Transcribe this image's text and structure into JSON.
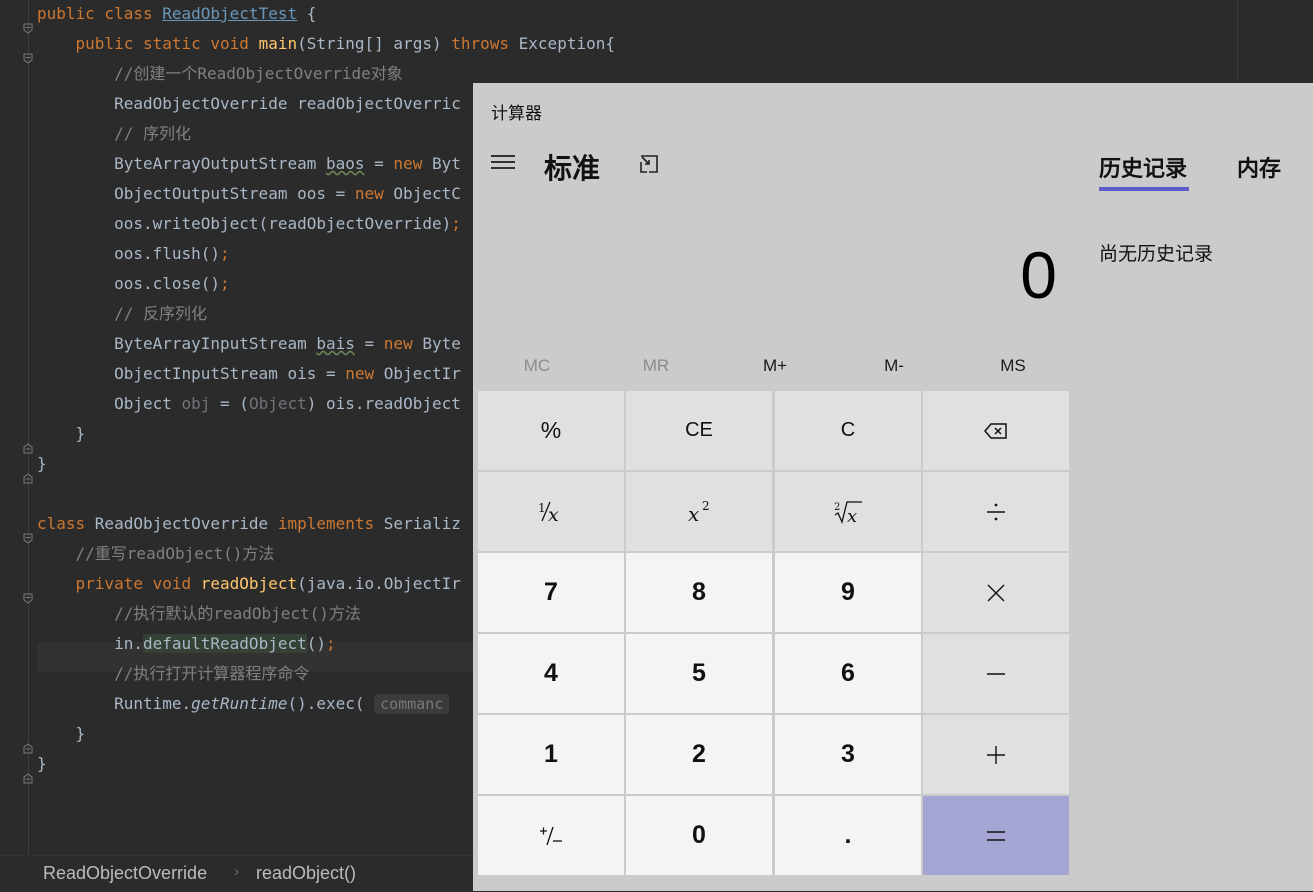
{
  "editor": {
    "lines": [
      {
        "tokens": [
          [
            "kw",
            "public class "
          ],
          [
            "cls-link",
            "ReadObjectTest"
          ],
          [
            "",
            " {"
          ]
        ]
      },
      {
        "tokens": [
          [
            "",
            "    "
          ],
          [
            "kw",
            "public static void "
          ],
          [
            "fn",
            "main"
          ],
          [
            "",
            "(String[] args) "
          ],
          [
            "kw",
            "throws "
          ],
          [
            "",
            "Exception{"
          ]
        ]
      },
      {
        "tokens": [
          [
            "",
            "        "
          ],
          [
            "cm",
            "//创建一个ReadObjectOverride对象"
          ]
        ]
      },
      {
        "tokens": [
          [
            "",
            "        ReadObjectOverride readObjectOverric"
          ]
        ]
      },
      {
        "tokens": [
          [
            "",
            "        "
          ],
          [
            "cm",
            "// 序列化"
          ]
        ]
      },
      {
        "tokens": [
          [
            "",
            "        ByteArrayOutputStream "
          ],
          [
            "wave",
            "baos"
          ],
          [
            "",
            " = "
          ],
          [
            "kw",
            "new "
          ],
          [
            "",
            "Byt"
          ]
        ]
      },
      {
        "tokens": [
          [
            "",
            "        ObjectOutputStream oos = "
          ],
          [
            "kw",
            "new "
          ],
          [
            "",
            "ObjectC"
          ]
        ]
      },
      {
        "tokens": [
          [
            "",
            "        oos.writeObject(readObjectOverride)"
          ],
          [
            "kw",
            ";"
          ]
        ]
      },
      {
        "tokens": [
          [
            "",
            "        oos.flush()"
          ],
          [
            "kw",
            ";"
          ]
        ]
      },
      {
        "tokens": [
          [
            "",
            "        oos.close()"
          ],
          [
            "kw",
            ";"
          ]
        ]
      },
      {
        "tokens": [
          [
            "",
            "        "
          ],
          [
            "cm",
            "// 反序列化"
          ]
        ]
      },
      {
        "tokens": [
          [
            "",
            "        ByteArrayInputStream "
          ],
          [
            "wave",
            "bais"
          ],
          [
            "",
            " = "
          ],
          [
            "kw",
            "new "
          ],
          [
            "",
            "Byte"
          ]
        ]
      },
      {
        "tokens": [
          [
            "",
            "        ObjectInputStream ois = "
          ],
          [
            "kw",
            "new "
          ],
          [
            "",
            "ObjectIr"
          ]
        ]
      },
      {
        "tokens": [
          [
            "",
            "        Object "
          ],
          [
            "gray",
            "obj"
          ],
          [
            "",
            " = ("
          ],
          [
            "gray",
            "Object"
          ],
          [
            "",
            ") ois.readObject"
          ]
        ]
      },
      {
        "tokens": [
          [
            "",
            "    }"
          ]
        ]
      },
      {
        "tokens": [
          [
            "",
            "}"
          ]
        ]
      },
      {
        "tokens": [
          [
            "",
            ""
          ]
        ]
      },
      {
        "tokens": [
          [
            "kw",
            "class "
          ],
          [
            "",
            "ReadObjectOverride "
          ],
          [
            "kw",
            "implements "
          ],
          [
            "",
            "Serializ"
          ]
        ]
      },
      {
        "tokens": [
          [
            "",
            "    "
          ],
          [
            "cm",
            "//重写readObject()方法"
          ]
        ]
      },
      {
        "tokens": [
          [
            "",
            "    "
          ],
          [
            "kw",
            "private void "
          ],
          [
            "fn",
            "readObject"
          ],
          [
            "",
            "(java.io.ObjectIr"
          ]
        ]
      },
      {
        "tokens": [
          [
            "",
            "        "
          ],
          [
            "cm",
            "//执行默认的readObject()方法"
          ]
        ]
      },
      {
        "tokens": [
          [
            "",
            "        in."
          ],
          [
            "hl-word",
            "defaultReadObject"
          ],
          [
            "",
            "()"
          ],
          [
            "kw",
            ";"
          ]
        ]
      },
      {
        "tokens": [
          [
            "",
            "        "
          ],
          [
            "cm",
            "//执行打开计算器程序命令"
          ]
        ]
      },
      {
        "tokens": [
          [
            "",
            "        Runtime."
          ],
          [
            "it",
            "getRuntime"
          ],
          [
            "",
            "().exec( "
          ],
          [
            "hint",
            "commanc"
          ]
        ]
      },
      {
        "tokens": [
          [
            "",
            "    }"
          ]
        ]
      },
      {
        "tokens": [
          [
            "",
            "}"
          ]
        ]
      }
    ]
  },
  "breadcrumb": {
    "item1": "ReadObjectOverride",
    "separator": "›",
    "item2": "readObject()"
  },
  "calculator": {
    "window_title": "计算器",
    "mode_title": "标准",
    "display_value": "0",
    "memory_buttons": [
      {
        "label": "MC",
        "enabled": false
      },
      {
        "label": "MR",
        "enabled": false
      },
      {
        "label": "M+",
        "enabled": true
      },
      {
        "label": "M-",
        "enabled": true
      },
      {
        "label": "MS",
        "enabled": true
      }
    ],
    "keys": {
      "percent": "%",
      "ce": "CE",
      "c": "C",
      "seven": "7",
      "eight": "8",
      "nine": "9",
      "four": "4",
      "five": "5",
      "six": "6",
      "one": "1",
      "two": "2",
      "three": "3",
      "zero": "0",
      "decimal": "."
    },
    "tabs": {
      "history": "历史记录",
      "memory": "内存"
    },
    "history_empty": "尚无历史记录",
    "accent_color": "#5d5acb",
    "equals_color": "#a4a5d3"
  }
}
